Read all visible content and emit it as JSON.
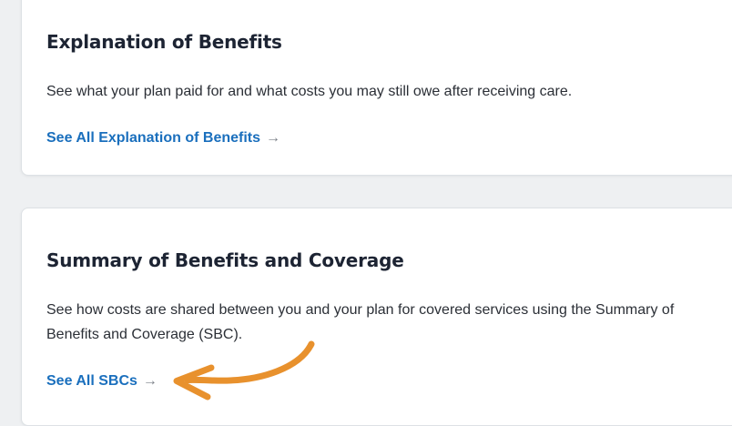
{
  "cards": [
    {
      "title": "Explanation of Benefits",
      "description": "See what your plan paid for and what costs you may still owe after receiving care.",
      "link_label": "See All Explanation of Benefits",
      "link_icon": "→"
    },
    {
      "title": "Summary of Benefits and Coverage",
      "description": "See how costs are shared between you and your plan for covered services using the Summary of Benefits and Coverage (SBC).",
      "link_label": "See All SBCs",
      "link_icon": "→"
    }
  ],
  "colors": {
    "link": "#1a6fbd",
    "annotation_arrow": "#e8912d",
    "background": "#eef0f2"
  }
}
